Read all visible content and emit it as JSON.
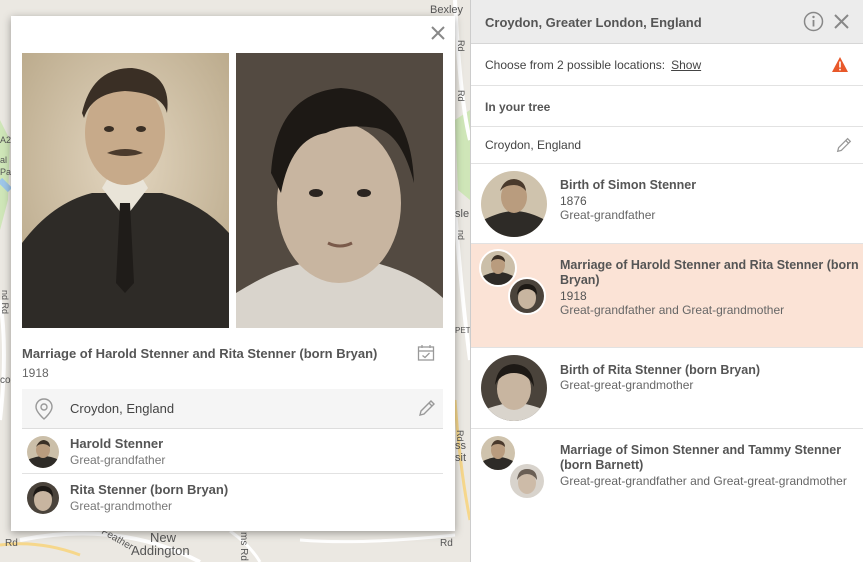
{
  "map": {
    "labels": [
      "Bexley F",
      "A2",
      "al",
      "Pa",
      "co",
      "nd Rd",
      "Rd",
      "Rd",
      "sle",
      "ss",
      "sit",
      "PET",
      "nd",
      "New",
      "Addington",
      "Feather",
      "ms Rd",
      "Rd",
      "Rd",
      "Rd"
    ]
  },
  "popup": {
    "title": "Marriage of Harold Stenner and Rita Stenner (born Bryan)",
    "year": "1918",
    "place": "Croydon, England",
    "people": [
      {
        "name": "Harold Stenner",
        "relation": "Great-grandfather"
      },
      {
        "name": "Rita Stenner (born Bryan)",
        "relation": "Great-grandmother"
      }
    ]
  },
  "panel": {
    "title": "Croydon, Greater London, England",
    "choose_text": "Choose from 2 possible locations:",
    "show_link": "Show",
    "in_your_tree": "In your tree",
    "tree_place": "Croydon, England",
    "events": [
      {
        "title": "Birth of Simon Stenner",
        "year": "1876",
        "relation": "Great-grandfather"
      },
      {
        "title": "Marriage of Harold Stenner and Rita Stenner (born Bryan)",
        "year": "1918",
        "relation": "Great-grandfather and Great-grandmother"
      },
      {
        "title": "Birth of Rita Stenner (born Bryan)",
        "year": "",
        "relation": "Great-great-grandmother"
      },
      {
        "title": "Marriage of Simon Stenner and Tammy Stenner (born Barnett)",
        "year": "",
        "relation": "Great-great-grandfather and Great-great-grandmother"
      }
    ]
  },
  "colors": {
    "highlight": "#fbe3d6",
    "warning": "#e8582a",
    "map_bg": "#ebe8e2",
    "park": "#cfe6b8"
  },
  "icons": [
    "close-icon",
    "calendar-icon",
    "location-pin-icon",
    "pencil-icon",
    "info-icon",
    "warning-icon"
  ]
}
